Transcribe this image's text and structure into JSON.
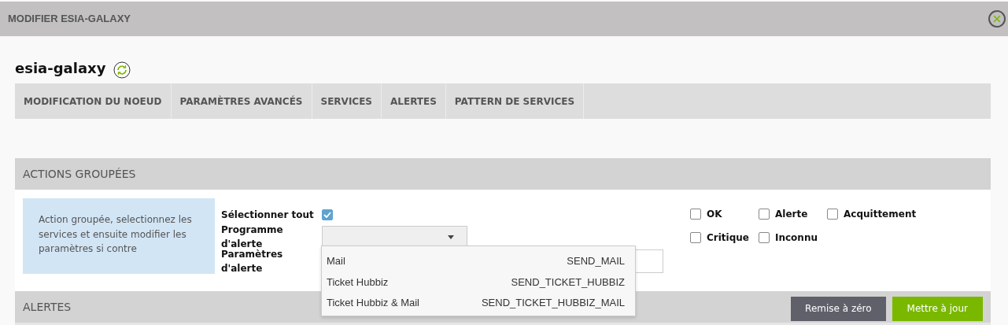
{
  "window": {
    "title": "MODIFIER ESIA-GALAXY"
  },
  "node": {
    "name": "esia-galaxy"
  },
  "tabs": [
    {
      "label": "MODIFICATION DU NOEUD",
      "selected": false
    },
    {
      "label": "PARAMÈTRES AVANCÉS",
      "selected": false
    },
    {
      "label": "SERVICES",
      "selected": false
    },
    {
      "label": "ALERTES",
      "selected": false
    },
    {
      "label": "PATTERN DE SERVICES",
      "selected": false
    }
  ],
  "bulk_actions": {
    "title": "ACTIONS GROUPÉES",
    "info": "Action groupée, selectionnez les services et ensuite modifier les paramètres si contre",
    "select_all": {
      "label": "Sélectionner tout",
      "checked": true
    },
    "alert_program": {
      "label": "Programme d'alerte",
      "expanded": true,
      "options": [
        {
          "label": "Mail",
          "code": "SEND_MAIL"
        },
        {
          "label": "Ticket Hubbiz",
          "code": "SEND_TICKET_HUBBIZ"
        },
        {
          "label": "Ticket Hubbiz & Mail",
          "code": "SEND_TICKET_HUBBIZ_MAIL"
        }
      ]
    },
    "alert_params": {
      "label": "Paramètres d'alerte"
    },
    "states": [
      {
        "label": "OK",
        "checked": false
      },
      {
        "label": "Alerte",
        "checked": false
      },
      {
        "label": "Acquittement",
        "checked": false
      },
      {
        "label": "Critique",
        "checked": false
      },
      {
        "label": "Inconnu",
        "checked": false
      }
    ]
  },
  "alerts": {
    "title": "ALERTES",
    "buttons": [
      {
        "label": "Remise à zéro",
        "kind": "reset"
      },
      {
        "label": "Mettre à jour",
        "kind": "update"
      }
    ]
  }
}
